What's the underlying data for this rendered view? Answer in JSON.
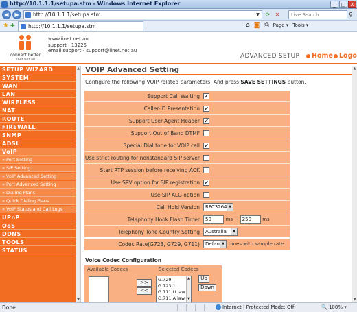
{
  "window": {
    "title": "http://10.1.1.1/setupa.stm - Windows Internet Explorer",
    "controls": {
      "minimize": "_",
      "maximize": "□",
      "close": "X"
    }
  },
  "browser": {
    "back_icon": "back-arrow-icon",
    "forward_icon": "forward-arrow-icon",
    "address": "http://10.1.1.1/setupa.stm",
    "search_placeholder": "Live Search",
    "tab_title": "http://10.1.1.1/setupa.stm",
    "page_menu": "Page",
    "tools_menu": "Tools"
  },
  "header": {
    "tagline": "connect better",
    "tagline_sub": "iinet.net.au",
    "site": "www.iinet.net.au",
    "support": "support - 13225",
    "email_support": "email support - support@iinet.net.au",
    "section": "ADVANCED SETUP",
    "home_link": "Home",
    "logout_link": "Logout",
    "brand_color": "#f26c21"
  },
  "sidebar": {
    "items": [
      {
        "label": "SETUP WIZARD"
      },
      {
        "label": "SYSTEM"
      },
      {
        "label": "WAN"
      },
      {
        "label": "LAN"
      },
      {
        "label": "WIRELESS"
      },
      {
        "label": "NAT"
      },
      {
        "label": "ROUTE"
      },
      {
        "label": "FIREWALL"
      },
      {
        "label": "SNMP"
      },
      {
        "label": "ADSL"
      },
      {
        "label": "VoIP"
      }
    ],
    "voip_sub": [
      {
        "label": "» Port Setting"
      },
      {
        "label": "» SIP Setting"
      },
      {
        "label": "» VoIP Advanced Setting"
      },
      {
        "label": "» Port Advanced Setting"
      },
      {
        "label": "» Dialing Plans"
      },
      {
        "label": "» Quick Dialing Plans"
      },
      {
        "label": "» VoIP Status and Call Logs"
      }
    ],
    "items_after": [
      {
        "label": "UPnP"
      },
      {
        "label": "QoS"
      },
      {
        "label": "DDNS"
      },
      {
        "label": "TOOLS"
      },
      {
        "label": "STATUS"
      }
    ]
  },
  "main": {
    "title": "VOIP Advanced Setting",
    "description_prefix": "Configure the following VOIP-related parameters. And press",
    "description_bold": "SAVE SETTINGS",
    "description_suffix": "button.",
    "settings": [
      {
        "label": "Support Call Waiting",
        "checked": true,
        "mark": "✔"
      },
      {
        "label": "Caller-ID Presentation",
        "checked": true,
        "mark": "✔"
      },
      {
        "label": "Support User-Agent Header",
        "checked": true,
        "mark": "✔"
      },
      {
        "label": "Support Out of Band DTMF",
        "checked": false,
        "mark": ""
      },
      {
        "label": "Special Dial tone for VOIP call",
        "checked": true,
        "mark": "✔"
      },
      {
        "label": "Use strict routing for nonstandard SIP server",
        "checked": false,
        "mark": ""
      },
      {
        "label": "Start RTP session before receiving ACK",
        "checked": false,
        "mark": ""
      },
      {
        "label": "Use SRV option for SIP registration",
        "checked": true,
        "mark": "✔"
      },
      {
        "label": "Use SIP ALG option",
        "checked": false,
        "mark": ""
      }
    ],
    "call_hold": {
      "label": "Call Hold Version",
      "value": "RFC3264"
    },
    "hook_flash": {
      "label": "Telephony Hook Flash Timer",
      "min": "50",
      "sep": "ms ~",
      "max": "250",
      "unit": "ms"
    },
    "tone_country": {
      "label": "Telephony Tone Country Setting",
      "value": "Australia"
    },
    "codec_rate": {
      "label": "Codec Rate(G723, G729, G711)",
      "value": "Default",
      "suffix": "times with sample rate"
    },
    "vcc": {
      "title": "Voice Codec Configuration",
      "available_header": "Available Codecs",
      "selected_header": "Selected Codecs",
      "add_btn": ">>",
      "remove_btn": "<<",
      "up_btn": "Up",
      "down_btn": "Down",
      "selected": [
        "G.729",
        "G.723.1",
        "G.711 U law",
        "G.711 A law"
      ]
    }
  },
  "status": {
    "left": "Done",
    "zone": "Internet | Protected Mode: Off",
    "zoom": "100%"
  }
}
